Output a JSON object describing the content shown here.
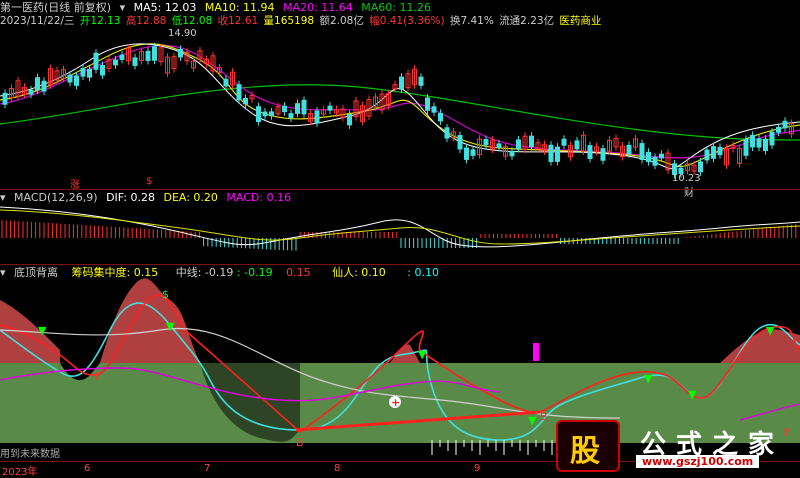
{
  "main": {
    "title": "第一医药(日线 前复权)",
    "ma": [
      {
        "label": "MA5: 12.03",
        "color": "#ffffff"
      },
      {
        "label": "MA10: 11.94",
        "color": "#ffff00"
      },
      {
        "label": "MA20: 11.64",
        "color": "#ff00ff"
      },
      {
        "label": "MA60: 11.26",
        "color": "#00cc00"
      }
    ],
    "quote": [
      {
        "label": "2023/11/22/三",
        "color": "#cccccc"
      },
      {
        "label": "开12.13",
        "color": "#00ff00"
      },
      {
        "label": "高12.88",
        "color": "#ff3030"
      },
      {
        "label": "低12.08",
        "color": "#00ff00"
      },
      {
        "label": "收12.61",
        "color": "#ff3030"
      },
      {
        "label": "量165198",
        "color": "#ffff00"
      },
      {
        "label": "额2.08亿",
        "color": "#cccccc"
      },
      {
        "label": "幅0.41(3.36%)",
        "color": "#ff3030"
      },
      {
        "label": "换7.41%",
        "color": "#cccccc"
      },
      {
        "label": "流通2.23亿",
        "color": "#cccccc"
      },
      {
        "label": "医药商业",
        "color": "#ffff00"
      }
    ],
    "high_label": "14.90",
    "low_label": "10.23",
    "tags": [
      "涨",
      "$",
      "财"
    ]
  },
  "macd": {
    "title": "MACD(12,26,9)",
    "items": [
      {
        "label": "DIF: 0.28",
        "color": "#ffffff"
      },
      {
        "label": "DEA: 0.20",
        "color": "#ffff00"
      },
      {
        "label": "MACD: 0.16",
        "color": "#ff00ff"
      }
    ]
  },
  "indicator": {
    "title": "底顶背离",
    "items": [
      {
        "label": "筹码集中度: 0.15",
        "color": "#ffff00"
      },
      {
        "label": "中线: -0.19",
        "color": "#cccccc"
      },
      {
        "label": ": -0.19",
        "color": "#00ff00"
      },
      {
        "label": "0.15",
        "color": "#ff3030"
      },
      {
        "label": "仙人: 0.10",
        "color": "#ffff00"
      },
      {
        "label": ": 0.10",
        "color": "#00ffff"
      }
    ],
    "footer_note": "用到未来数据"
  },
  "axis": {
    "year_label": "2023年",
    "months": [
      "6",
      "7",
      "8",
      "9"
    ]
  },
  "watermark": {
    "logo_char": "股",
    "brand": "公式之家",
    "url": "www.gszj100.com"
  }
}
